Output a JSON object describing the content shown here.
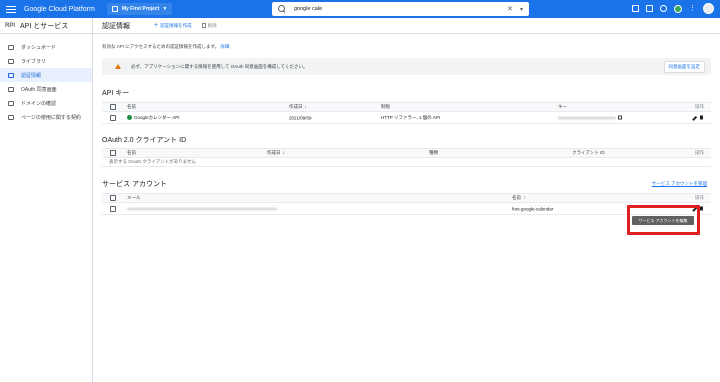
{
  "topbar": {
    "brand": "Google Cloud Platform",
    "project": "My First Project",
    "search_query": "google cale",
    "clear": "✕",
    "dropdown": "▾"
  },
  "sidenav": {
    "logo": "RPI",
    "title": "API とサービス",
    "items": [
      {
        "label": "ダッシュボード",
        "icon": "dashboard-icon"
      },
      {
        "label": "ライブラリ",
        "icon": "library-icon"
      },
      {
        "label": "認証情報",
        "icon": "key-icon",
        "active": true
      },
      {
        "label": "OAuth 同意画面",
        "icon": "consent-icon"
      },
      {
        "label": "ドメインの確認",
        "icon": "domain-check-icon"
      },
      {
        "label": "ページの使用に関する契約",
        "icon": "agreement-icon"
      }
    ]
  },
  "header": {
    "title": "認証情報",
    "create": "認証情報を作成",
    "delete": "削除"
  },
  "intro": {
    "text": "有効な API にアクセスするための認証情報を作成します。",
    "link": "詳細"
  },
  "banner": {
    "text": "必ず、アプリケーションに関する情報を使用して OAuth 同意画面を構成してください。",
    "button": "同意画面を設定"
  },
  "api_keys": {
    "title": "API キー",
    "columns": {
      "name": "名前",
      "created": "作成日",
      "restriction": "制限",
      "key": "キー",
      "ops": "操作"
    },
    "rows": [
      {
        "name": "Googleカレンダー API",
        "created": "2021/09/09",
        "restriction": "HTTP リファラー, 1 個の API"
      }
    ]
  },
  "oauth": {
    "title": "OAuth 2.0 クライアント ID",
    "columns": {
      "name": "名前",
      "created": "作成日",
      "type": "種類",
      "client_id": "クライアント ID",
      "ops": "操作"
    },
    "empty": "表示する OAuth クライアントがありません"
  },
  "service_accounts": {
    "title": "サービス アカウント",
    "manage": "サービス アカウントを管理",
    "columns": {
      "email": "メール",
      "name": "名前",
      "ops": "操作"
    },
    "rows": [
      {
        "name": "fors-google-calendar"
      }
    ]
  },
  "tooltip": "サービス アカウントを編集",
  "colors": {
    "topbar": "#1a73e8",
    "highlight": "#e02020",
    "active_nav": "#e8f0fe"
  }
}
